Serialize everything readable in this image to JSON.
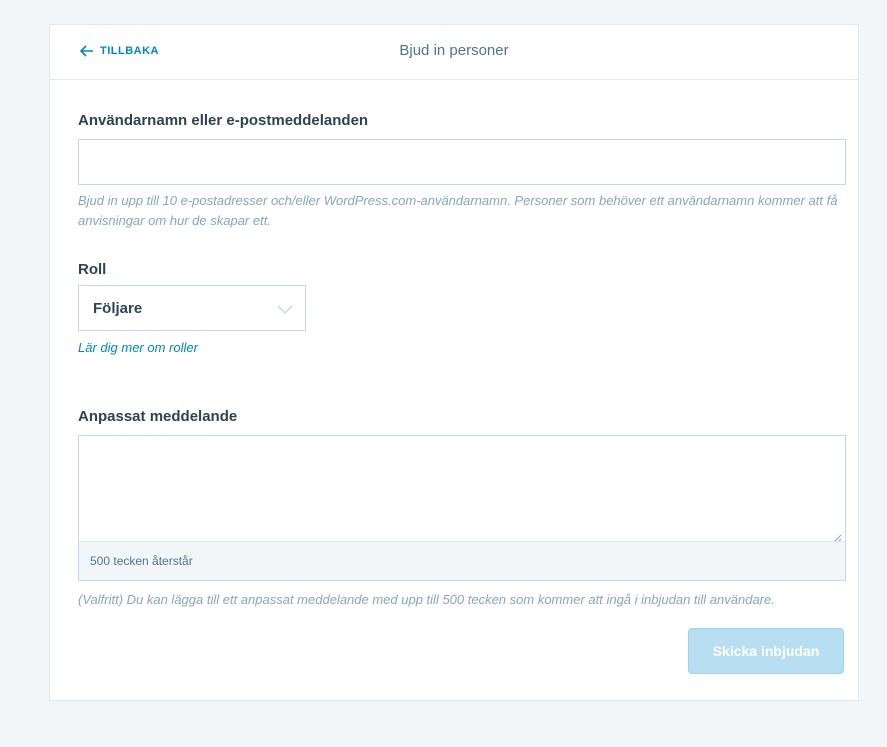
{
  "header": {
    "back_label": "TILLBAKA",
    "title": "Bjud in personer"
  },
  "form": {
    "users_label": "Användarnamn eller e-postmeddelanden",
    "users_value": "",
    "users_help": "Bjud in upp till 10 e-postadresser och/eller WordPress.com-användarnamn. Personer som behöver ett användarnamn kommer att få anvisningar om hur de skapar ett.",
    "role_label": "Roll",
    "role_value": "Följare",
    "role_link": "Lär dig mer om roller",
    "message_label": "Anpassat meddelande",
    "message_value": "",
    "message_counter": "500 tecken återstår",
    "message_help": "(Valfritt) Du kan lägga till ett anpassat meddelande med upp till 500 tecken som kommer att ingå i inbjudan till användare.",
    "submit_label": "Skicka inbjudan"
  },
  "icons": {
    "back": "arrow-left-icon",
    "role_dropdown": "chevron-down-icon",
    "resize": "resize-handle-icon"
  },
  "colors": {
    "accent": "#0087be",
    "text": "#2e4453",
    "muted": "#87a6bc",
    "button_disabled": "#b7dff1"
  }
}
